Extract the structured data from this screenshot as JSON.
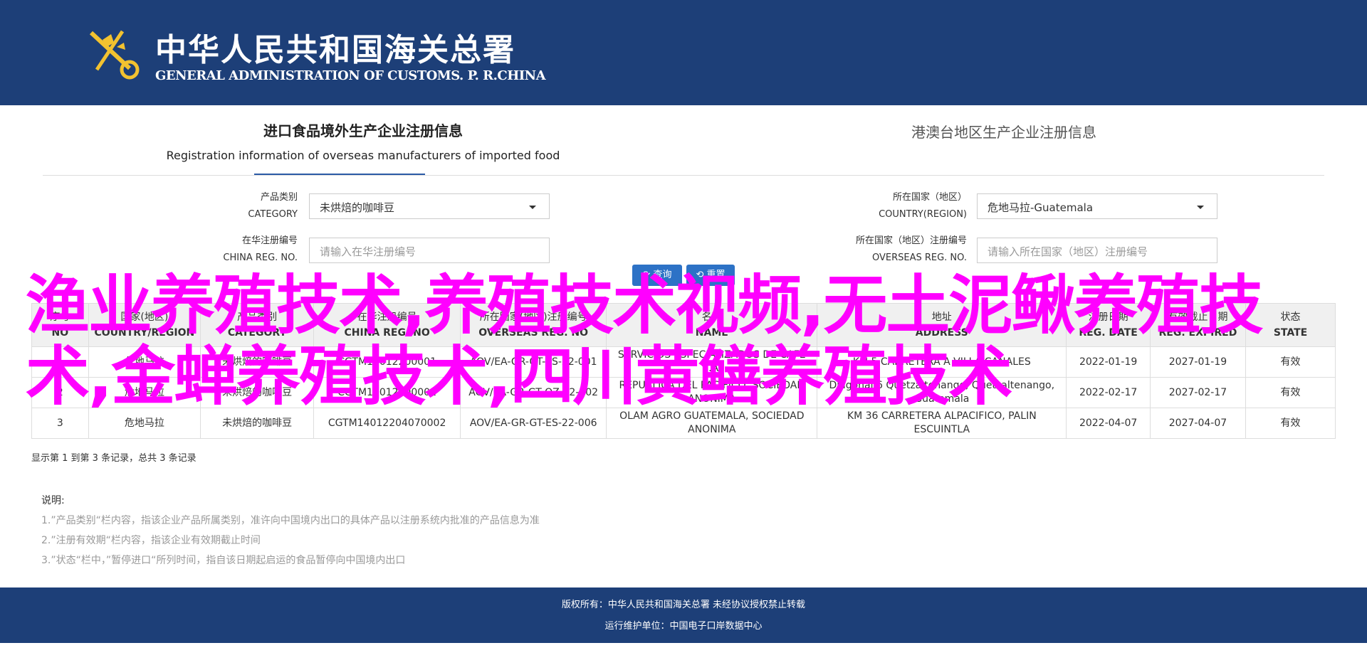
{
  "header": {
    "title_cn": "中华人民共和国海关总署",
    "title_en": "GENERAL ADMINISTRATION OF CUSTOMS. P. R.CHINA",
    "logo_icon": "customs-emblem-icon",
    "background": "#1d3f78"
  },
  "tabs": {
    "left_cn": "进口食品境外生产企业注册信息",
    "left_en": "Registration information of overseas manufacturers of imported food",
    "right_cn": "港澳台地区生产企业注册信息"
  },
  "form": {
    "category_label_cn": "产品类别",
    "category_label_en": "CATEGORY",
    "category_value": "未烘焙的咖啡豆",
    "country_label_cn": "所在国家（地区）",
    "country_label_en": "COUNTRY(REGION)",
    "country_value": "危地马拉-Guatemala",
    "china_reg_label_cn": "在华注册编号",
    "china_reg_label_en": "CHINA REG. NO.",
    "china_reg_placeholder": "请输入在华注册编号",
    "overseas_reg_label_cn": "所在国家（地区）注册编号",
    "overseas_reg_label_en": "OVERSEAS REG. NO.",
    "overseas_reg_placeholder": "请输入所在国家（地区）注册编号"
  },
  "buttons": {
    "search": "查询",
    "reset": "重置"
  },
  "table": {
    "headers": [
      {
        "cn": "序号",
        "en": "NO"
      },
      {
        "cn": "国家(地区)",
        "en": "COUNTRY/REGION"
      },
      {
        "cn": "产品类别",
        "en": "CATEGORY"
      },
      {
        "cn": "在华注册编号",
        "en": "CHINA REG. NO"
      },
      {
        "cn": "所在国家(地区)注册编号",
        "en": "OVERSEAS REG. NO"
      },
      {
        "cn": "名称",
        "en": "NAME"
      },
      {
        "cn": "地址",
        "en": "ADDRESS"
      },
      {
        "cn": "注册日期",
        "en": "REG. DATE"
      },
      {
        "cn": "有效截止日期",
        "en": "REG. EXPIRED"
      },
      {
        "cn": "状态",
        "en": "STATE"
      }
    ],
    "rows": [
      [
        "1",
        "危地马拉",
        "未烘焙的咖啡豆",
        "CGTM14012200001",
        "AOV/EA-GR-GT-ES-22-001",
        "SERVICIOS ESPECIALIZADOS DE CAFE S.A.",
        "KM 5 CARRETERA A VILLA CANALES",
        "2022-01-19",
        "2027-01-19",
        "有效"
      ],
      [
        "2",
        "危地马拉",
        "未烘焙的咖啡豆",
        "CGTM14012200002",
        "AOV/EA-GR-GT-QZ-22-002",
        "REPUBLICA DEL PACIFICO, SOCIEDAD ANONIMA",
        "Diagonal 6 Quetzaltenango, Quetzaltenango, Guatemala",
        "2022-02-17",
        "2027-02-17",
        "有效"
      ],
      [
        "3",
        "危地马拉",
        "未烘焙的咖啡豆",
        "CGTM14012204070002",
        "AOV/EA-GR-GT-ES-22-006",
        "OLAM AGRO GUATEMALA, SOCIEDAD ANONIMA",
        "KM 36 CARRETERA ALPACIFICO, PALIN ESCUINTLA",
        "2022-04-07",
        "2027-04-07",
        "有效"
      ]
    ]
  },
  "row_info": "显示第 1 到第 3 条记录，总共 3 条记录",
  "notes": {
    "title": "说明:",
    "items": [
      "1.”产品类别“栏内容，指该企业产品所属类别，准许向中国境内出口的具体产品以注册系统内批准的产品信息为准",
      "2.”注册有效期“栏内容，指该企业有效期截止时间",
      "3.”状态“栏中，”暂停进口“所列时间，指自该日期起启运的食品暂停向中国境内出口"
    ]
  },
  "footer": {
    "line1": "版权所有：中华人民共和国海关总署 未经协议授权禁止转载",
    "line2": "运行维护单位：中国电子口岸数据中心"
  },
  "overlay_text": "渔业养殖技术,养殖技术视频,无土泥鳅养殖技术,金蝉养殖技术,四川黄鳝养殖技术"
}
